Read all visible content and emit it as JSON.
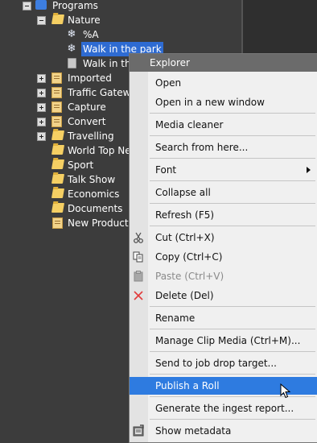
{
  "tree": {
    "programs": "Programs",
    "nature": "Nature",
    "percent_a": "%A",
    "walk_park": "Walk in the park",
    "walk_the": "Walk in the",
    "imported": "Imported",
    "traffic": "Traffic Gatewa",
    "capture": "Capture",
    "convert": "Convert",
    "travelling": "Travelling",
    "world_top": "World Top Ne",
    "sport": "Sport",
    "talk_show": "Talk Show",
    "economics": "Economics",
    "documents": "Documents",
    "new_production": "New Productio"
  },
  "menu": {
    "title": "Explorer",
    "open": "Open",
    "open_new": "Open in a new window",
    "media_cleaner": "Media cleaner",
    "search_here": "Search from here...",
    "font": "Font",
    "collapse_all": "Collapse all",
    "refresh": "Refresh (F5)",
    "cut": "Cut (Ctrl+X)",
    "copy": "Copy (Ctrl+C)",
    "paste": "Paste (Ctrl+V)",
    "delete": "Delete (Del)",
    "rename": "Rename",
    "manage_clip": "Manage Clip Media (Ctrl+M)...",
    "send_job": "Send to job drop target...",
    "publish_roll": "Publish a Roll",
    "ingest_report": "Generate the ingest report...",
    "show_metadata": "Show metadata"
  },
  "colors": {
    "highlight": "#2e7be0",
    "tree_selection": "#2e6bd2",
    "menu_title_bg": "#6b6b6b"
  }
}
